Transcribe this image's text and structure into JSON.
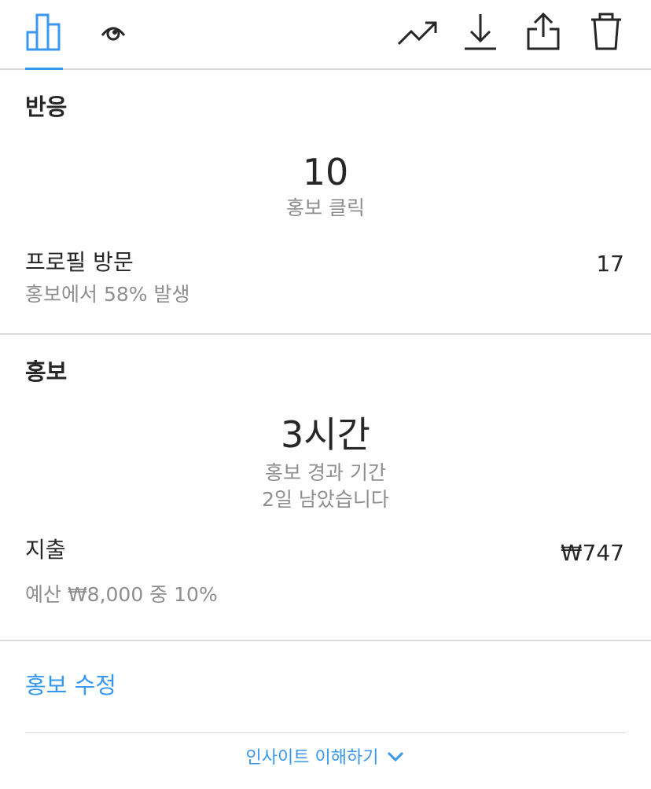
{
  "toolbar": {
    "icons": [
      "bar-chart-icon",
      "eye-icon",
      "trending-up-icon",
      "download-icon",
      "share-icon",
      "trash-icon"
    ],
    "accent_color": "#3897f0"
  },
  "engagement": {
    "title": "반응",
    "promo_clicks_value": "10",
    "promo_clicks_label": "홍보 클릭",
    "profile_visits_label": "프로필 방문",
    "profile_visits_value": "17",
    "profile_visits_sub": "홍보에서 58% 발생"
  },
  "promotion": {
    "title": "홍보",
    "elapsed_value": "3시간",
    "elapsed_label": "홍보 경과 기간",
    "remaining_label": "2일 남았습니다",
    "spend_label": "지출",
    "spend_value": "₩747",
    "budget_sub": "예산 ₩8,000 중 10%"
  },
  "actions": {
    "edit_promotion": "홍보 수정",
    "understand_insights": "인사이트 이해하기"
  }
}
